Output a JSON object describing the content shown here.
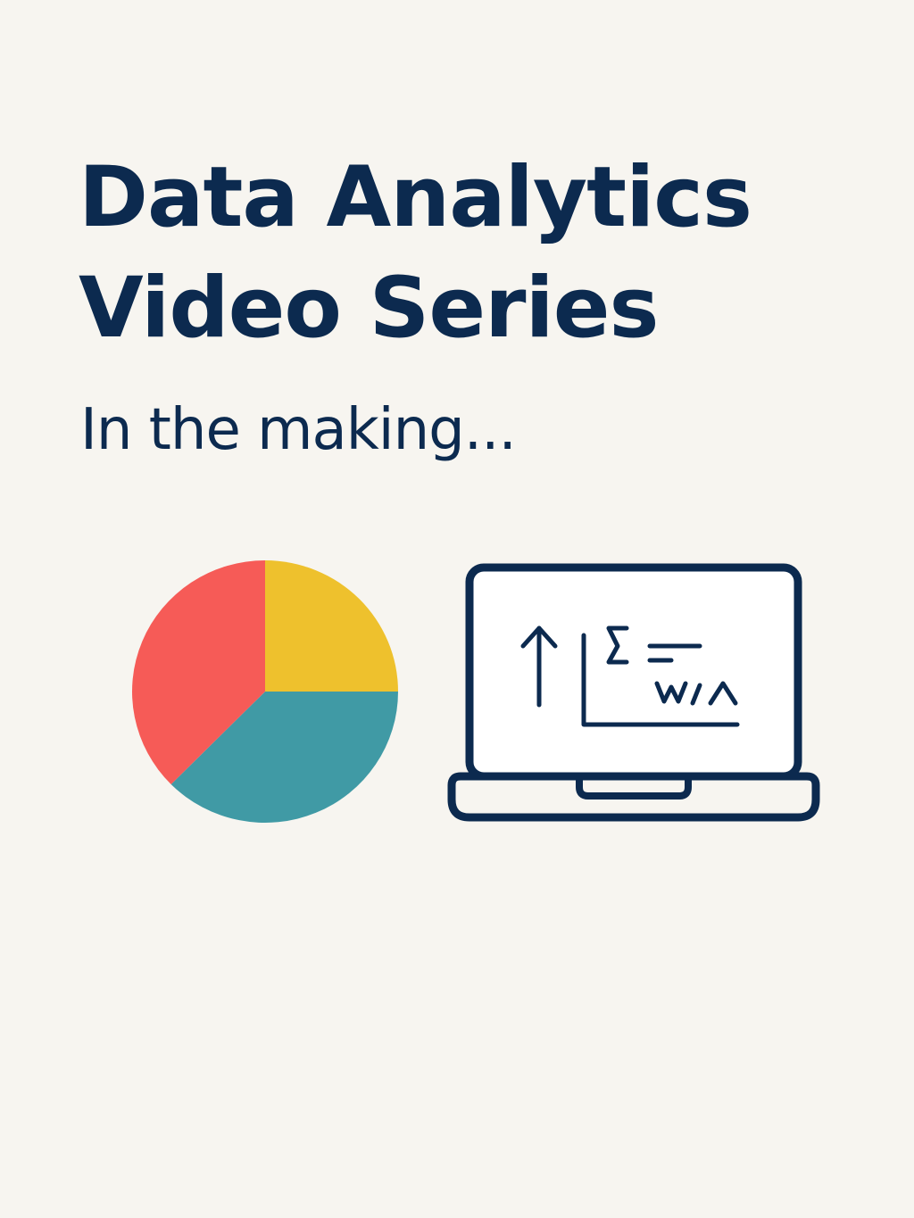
{
  "poster": {
    "background_color": "#f7f5f0",
    "text_color": "#0c2a4f",
    "title_lines": [
      "Data Analytics",
      "Video Series"
    ],
    "subtitle": "In the making..."
  },
  "pie_icon": {
    "shares": [
      {
        "color": "#eec12d",
        "fraction": 0.25
      },
      {
        "color": "#409aa5",
        "fraction": 0.375
      },
      {
        "color": "#f65b57",
        "fraction": 0.375
      }
    ]
  },
  "laptop_icon": {
    "stroke_color": "#0c2a4f",
    "screen_color": "#ffffff",
    "glyphs": {
      "arrow": "up-arrow-icon",
      "sigma": "sigma-icon",
      "equals": "equals-icon",
      "wave": "w/^"
    }
  }
}
